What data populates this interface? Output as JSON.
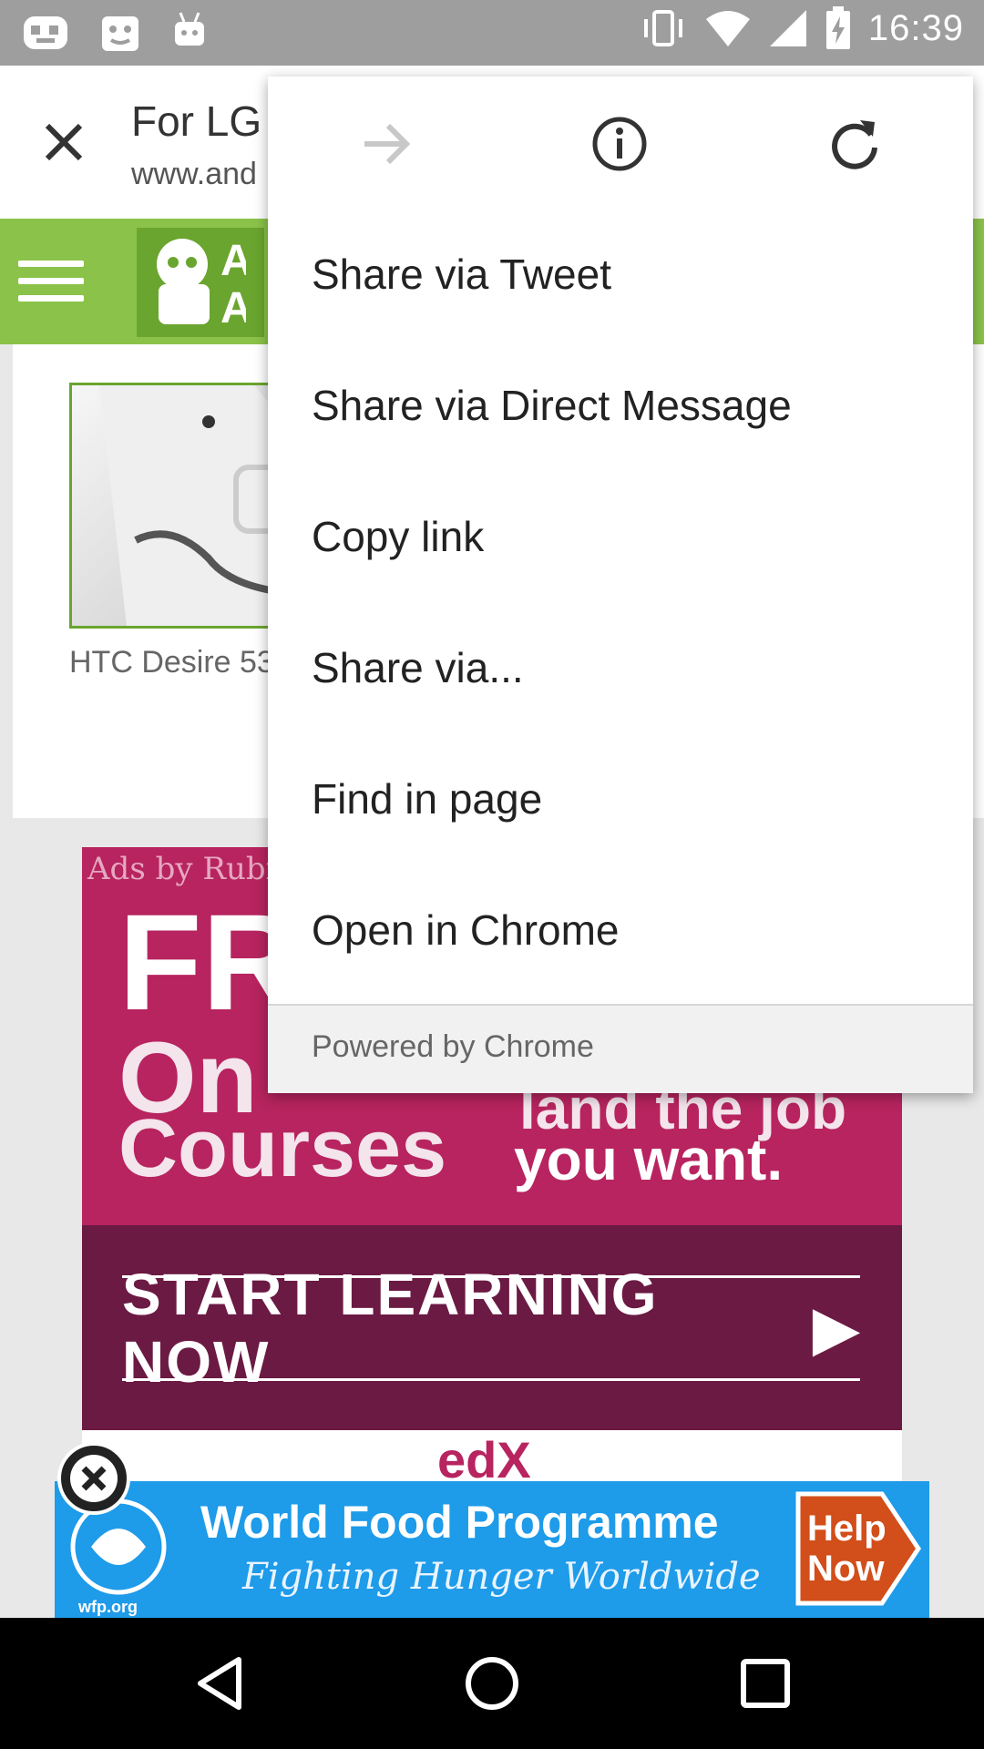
{
  "status_bar": {
    "time": "16:39",
    "left_icons": [
      "notification-bot-icon",
      "notification-face-icon",
      "android-icon"
    ],
    "right_icons": [
      "vibrate-icon",
      "wifi-icon",
      "signal-icon",
      "battery-charging-icon"
    ]
  },
  "toolbar": {
    "title": "For LG",
    "url": "www.and"
  },
  "site": {
    "brand_color": "#8bc34a",
    "logo_letters": "A\nAU"
  },
  "content": {
    "thumbnail_caption": "HTC Desire 53"
  },
  "ad": {
    "label": "Ads by Rubi",
    "line1": "FR",
    "line2": "On",
    "line3": "Courses",
    "right_line1": "land the job",
    "right_line2": "you want.",
    "cta": "START LEARNING NOW",
    "brand": "edX",
    "color": "#b7245f"
  },
  "banner": {
    "title": "World Food Programme",
    "subtitle": "Fighting Hunger Worldwide",
    "url": "wfp.org",
    "help": "Help\nNow",
    "color": "#1e9be9"
  },
  "menu": {
    "icons": [
      "forward-icon",
      "info-icon",
      "refresh-icon"
    ],
    "items": [
      {
        "label": "Share via Tweet"
      },
      {
        "label": "Share via Direct Message"
      },
      {
        "label": "Copy link"
      },
      {
        "label": "Share via..."
      },
      {
        "label": "Find in page"
      },
      {
        "label": "Open in Chrome"
      }
    ],
    "footer": "Powered by Chrome"
  },
  "nav": {
    "buttons": [
      "back-icon",
      "home-icon",
      "recents-icon"
    ]
  }
}
